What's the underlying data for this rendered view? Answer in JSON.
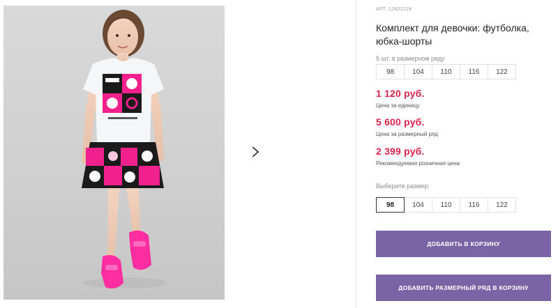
{
  "product": {
    "article_label": "АРТ.",
    "article_value": "12422124",
    "title": "Комплект для девочки: футболка, юбка-шорты"
  },
  "size_row": {
    "label": "5 шт. в размерном ряду",
    "sizes": [
      "98",
      "104",
      "110",
      "116",
      "122"
    ]
  },
  "prices": [
    {
      "value": "1 120 руб.",
      "note": "Цена за единицу"
    },
    {
      "value": "5 600 руб.",
      "note": "Цена за размерный ряд"
    },
    {
      "value": "2 399 руб.",
      "note": "Рекомендуемая розничная цена"
    }
  ],
  "size_select": {
    "label": "Выберите размер:",
    "sizes": [
      "98",
      "104",
      "110",
      "116",
      "122"
    ],
    "selected": "98"
  },
  "buttons": {
    "add_to_cart": "ДОБАВИТЬ В КОРЗИНУ",
    "add_row_to_cart": "ДОБАВИТЬ РАЗМЕРНЫЙ РЯД В КОРЗИНУ"
  },
  "gallery": {
    "next_icon": "chevron-right-icon"
  },
  "colors": {
    "price": "#e0224b",
    "button": "#7b64a6",
    "print_pink": "#f0208c"
  }
}
